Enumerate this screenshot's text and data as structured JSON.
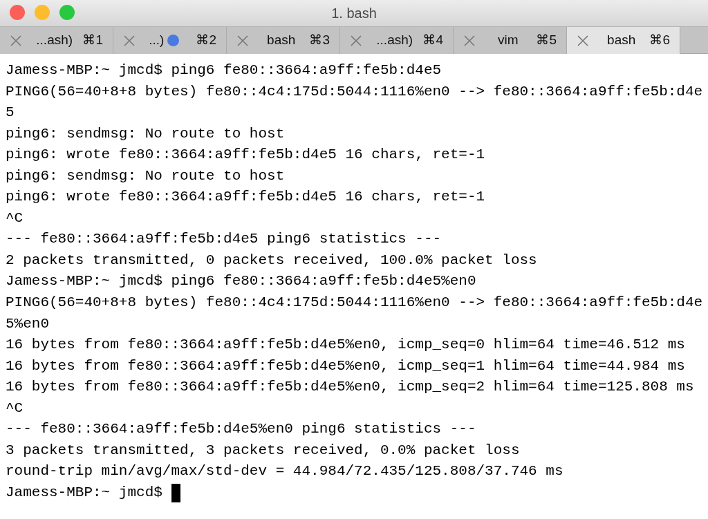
{
  "window": {
    "title": "1. bash"
  },
  "tabs": [
    {
      "label": "...ash)",
      "shortcut": "⌘1",
      "activity": false,
      "selected": false
    },
    {
      "label": "...)",
      "shortcut": "⌘2",
      "activity": true,
      "selected": false
    },
    {
      "label": "bash",
      "shortcut": "⌘3",
      "activity": false,
      "selected": false
    },
    {
      "label": "...ash)",
      "shortcut": "⌘4",
      "activity": false,
      "selected": false
    },
    {
      "label": "vim",
      "shortcut": "⌘5",
      "activity": false,
      "selected": false
    },
    {
      "label": "bash",
      "shortcut": "⌘6",
      "activity": false,
      "selected": true
    }
  ],
  "terminal": {
    "lines": [
      {
        "text": "Jamess-MBP:~ jmcd$ ping6 fe80::3664:a9ff:fe5b:d4e5"
      },
      {
        "text": "PING6(56=40+8+8 bytes) fe80::4c4:175d:5044:1116%en0 --> fe80::3664:a9ff:fe5b:d4e"
      },
      {
        "text": "5"
      },
      {
        "text": "ping6: sendmsg: No route to host"
      },
      {
        "text": "ping6: wrote fe80::3664:a9ff:fe5b:d4e5 16 chars, ret=-1"
      },
      {
        "text": "ping6: sendmsg: No route to host"
      },
      {
        "text": "ping6: wrote fe80::3664:a9ff:fe5b:d4e5 16 chars, ret=-1"
      },
      {
        "text": "^C"
      },
      {
        "text": "--- fe80::3664:a9ff:fe5b:d4e5 ping6 statistics ---"
      },
      {
        "text": "2 packets transmitted, 0 packets received, 100.0% packet loss"
      },
      {
        "text": "Jamess-MBP:~ jmcd$ ping6 fe80::3664:a9ff:fe5b:d4e5%en0"
      },
      {
        "text": "PING6(56=40+8+8 bytes) fe80::4c4:175d:5044:1116%en0 --> fe80::3664:a9ff:fe5b:d4e"
      },
      {
        "text": "5%en0"
      },
      {
        "text": "16 bytes from fe80::3664:a9ff:fe5b:d4e5%en0, icmp_seq=0 hlim=64 time=46.512 ms"
      },
      {
        "text": "16 bytes from fe80::3664:a9ff:fe5b:d4e5%en0, icmp_seq=1 hlim=64 time=44.984 ms"
      },
      {
        "text": "16 bytes from fe80::3664:a9ff:fe5b:d4e5%en0, icmp_seq=2 hlim=64 time=125.808 ms"
      },
      {
        "text": "^C"
      },
      {
        "text": "--- fe80::3664:a9ff:fe5b:d4e5%en0 ping6 statistics ---"
      },
      {
        "text": "3 packets transmitted, 3 packets received, 0.0% packet loss"
      },
      {
        "text": "round-trip min/avg/max/std-dev = 44.984/72.435/125.808/37.746 ms"
      },
      {
        "text": "Jamess-MBP:~ jmcd$",
        "cursor": true
      }
    ]
  }
}
